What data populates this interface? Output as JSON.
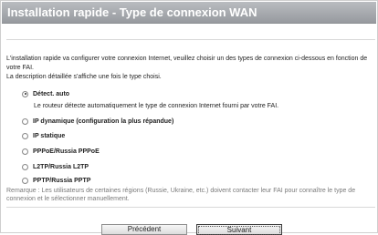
{
  "header": {
    "title": "Installation rapide - Type de connexion WAN"
  },
  "intro": {
    "line1": "L'installation rapide va configurer votre connexion Internet, veuillez choisir un des types de connexion ci-dessous en fonction de votre FAI.",
    "line2": "La description détaillée s'affiche une fois le type choisi."
  },
  "options": [
    {
      "label": "Détect. auto",
      "selected": true
    },
    {
      "label": "IP dynamique (configuration la plus répandue)",
      "selected": false
    },
    {
      "label": "IP statique",
      "selected": false
    },
    {
      "label": "PPPoE/Russia PPPoE",
      "selected": false
    },
    {
      "label": "L2TP/Russia L2TP",
      "selected": false
    },
    {
      "label": "PPTP/Russia PPTP",
      "selected": false
    }
  ],
  "auto_description": "Le routeur détecte automatiquement le type de connexion Internet fourni par votre FAI.",
  "remark": "Remarque : Les utilisateurs de certaines régions (Russie, Ukraine, etc.) doivent contacter leur FAI pour connaître le type de connexion et le sélectionner manuellement.",
  "buttons": {
    "previous": "Précédent",
    "next": "Suivant"
  }
}
